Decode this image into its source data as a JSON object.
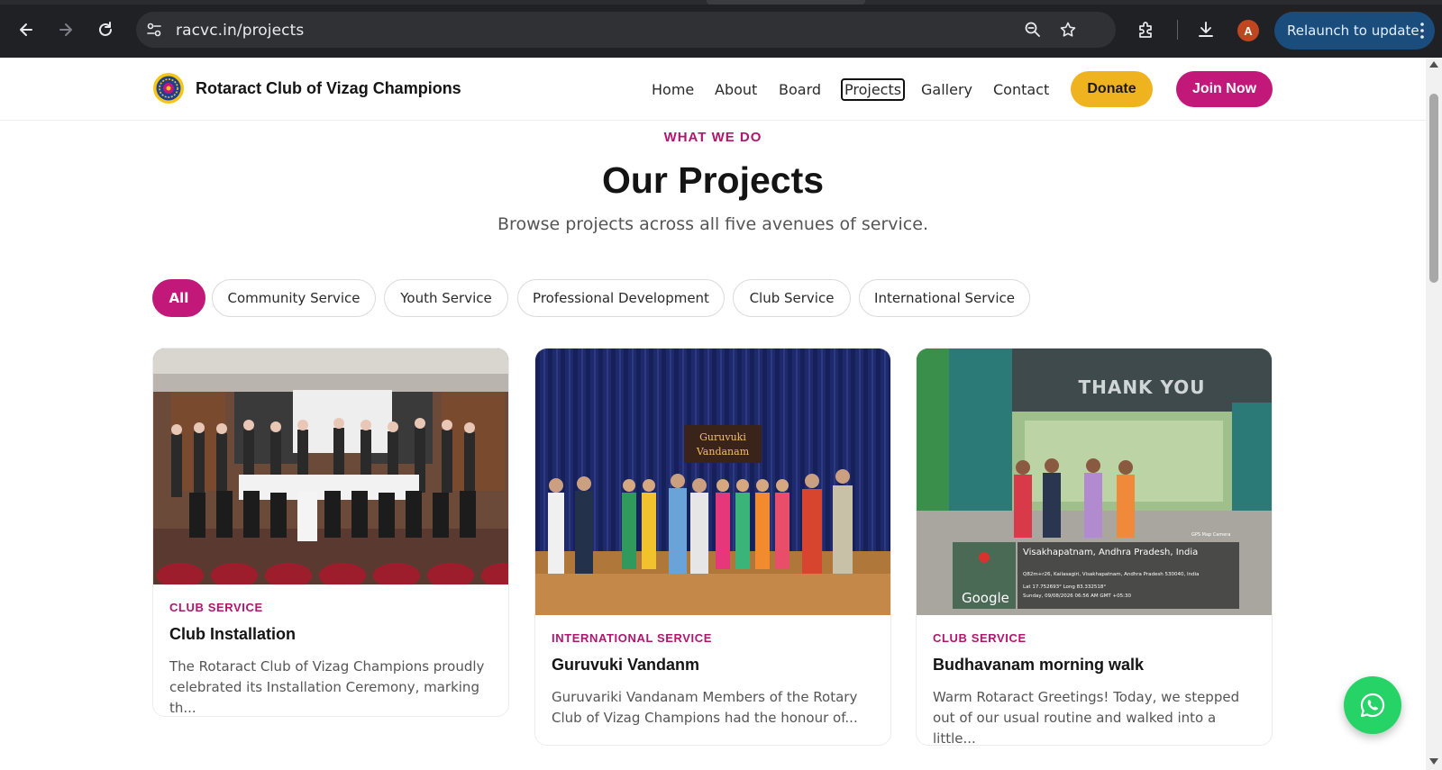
{
  "browser": {
    "url": "racvc.in/projects",
    "avatar_letter": "A",
    "relaunch_label": "Relaunch to update",
    "icons": [
      "back-icon",
      "forward-icon",
      "reload-icon",
      "site-info-icon",
      "zoom-icon",
      "star-icon",
      "extensions-icon",
      "download-icon",
      "more-icon"
    ]
  },
  "header": {
    "brand": "Rotaract Club of Vizag Champions",
    "menu": [
      "Home",
      "About",
      "Board",
      "Projects",
      "Gallery",
      "Contact"
    ],
    "active_menu": "Projects",
    "donate_label": "Donate",
    "join_label": "Join Now"
  },
  "hero": {
    "eyebrow": "WHAT WE DO",
    "title": "Our Projects",
    "subtitle": "Browse projects across all five avenues of service."
  },
  "filters": [
    "All",
    "Community Service",
    "Youth Service",
    "Professional Development",
    "Club Service",
    "International Service"
  ],
  "active_filter": "All",
  "cards": [
    {
      "category": "CLUB SERVICE",
      "title": "Club Installation",
      "description": "The Rotaract Club of Vizag Champions proudly celebrated its Installation Ceremony, marking th..."
    },
    {
      "category": "INTERNATIONAL SERVICE",
      "title": "Guruvuki Vandanm",
      "description": "Guruvariki Vandanam Members of the Rotary Club of Vizag Champions had the honour of...",
      "banner_text": "Guruvuki Vandanam"
    },
    {
      "category": "CLUB SERVICE",
      "title": "Budhavanam morning walk",
      "description": "Warm Rotaract Greetings! Today, we stepped out of our usual routine and walked into a little...",
      "arch_text": "THANK YOU",
      "geotag_place": "Visakhapatnam, Andhra Pradesh, India",
      "geotag_address": "Q82m+r26, Kailasagiri, Visakhapatnam, Andhra Pradesh 530040, India",
      "geotag_coords": "Lat 17.752693° Long 83.332518°",
      "geotag_time": "Sunday, 09/08/2026 06:56 AM GMT +05:30",
      "geotag_app": "GPS Map Camera",
      "map_brand": "Google"
    }
  ],
  "colors": {
    "accent": "#c2187a",
    "donate": "#f0b320",
    "whatsapp": "#25d366"
  }
}
